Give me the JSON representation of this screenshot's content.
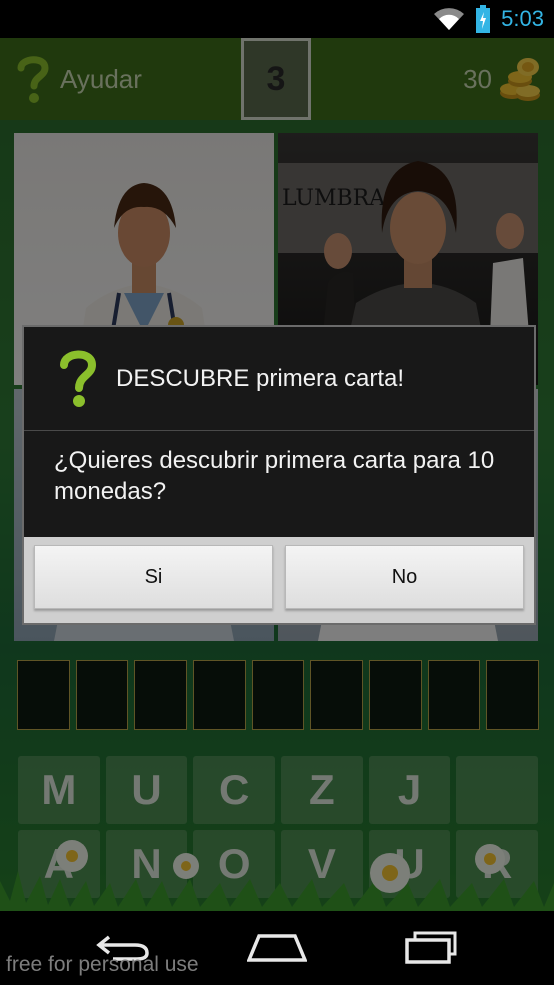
{
  "status_bar": {
    "time": "5:03",
    "icons": [
      "wifi-icon",
      "battery-icon"
    ]
  },
  "header": {
    "help_label": "Ayudar",
    "level": "3",
    "coins": "30"
  },
  "answer_slots": 9,
  "keyboard": {
    "row1": [
      "M",
      "U",
      "C",
      "Z",
      "J",
      ""
    ],
    "row2": [
      "A",
      "N",
      "O",
      "V",
      "U",
      "R"
    ]
  },
  "dialog": {
    "title": "DESCUBRE primera carta!",
    "message": "¿Quieres descubrir primera carta para 10 monedas?",
    "yes_label": "Si",
    "no_label": "No"
  },
  "watermark": "free for personal use",
  "colors": {
    "accent": "#33b5e5",
    "header_bg": "#3e6e1a",
    "help_icon": "#8bbf2c",
    "coin": "#f2c230"
  }
}
